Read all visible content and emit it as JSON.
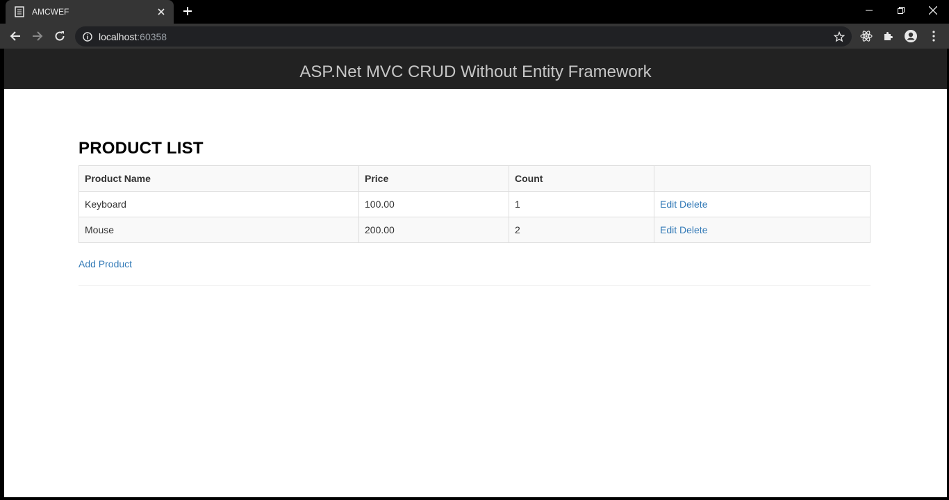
{
  "browser": {
    "tab_title": "AMCWEF",
    "url_host": "localhost",
    "url_port": ":60358"
  },
  "site": {
    "title": "ASP.Net MVC CRUD Without Entity Framework"
  },
  "page": {
    "heading": "PRODUCT LIST",
    "columns": [
      "Product Name",
      "Price",
      "Count",
      ""
    ],
    "rows": [
      {
        "name": "Keyboard",
        "price": "100.00",
        "count": "1",
        "edit": "Edit",
        "delete": "Delete"
      },
      {
        "name": "Mouse",
        "price": "200.00",
        "count": "2",
        "edit": "Edit",
        "delete": "Delete"
      }
    ],
    "add_link": "Add Product"
  }
}
